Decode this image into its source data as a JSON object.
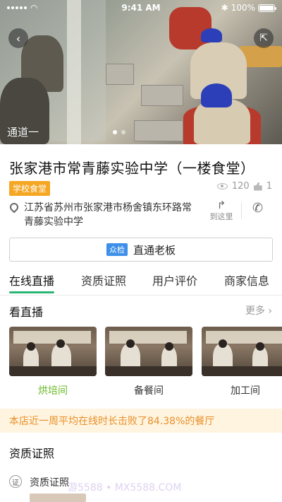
{
  "status_bar": {
    "time": "9:41 AM",
    "battery": "100%"
  },
  "hero": {
    "channel_label": "通道一"
  },
  "store": {
    "name": "张家港市常青藤实验中学（一楼食堂）",
    "tag": "学校食堂",
    "views": "120",
    "likes": "1",
    "address": "江苏省苏州市张家港市杨舍镇东环路常青藤实验中学",
    "route_label": "到这里"
  },
  "boss": {
    "badge": "众检",
    "label": "直通老板"
  },
  "tabs": [
    "在线直播",
    "资质证照",
    "用户评价",
    "商家信息"
  ],
  "live": {
    "heading": "看直播",
    "more": "更多",
    "cameras": [
      "烘培间",
      "备餐间",
      "加工间"
    ]
  },
  "banner": "本店近一周平均在线时长击败了84.38%的餐厅",
  "qualification": {
    "heading": "资质证照",
    "icon_text": "证",
    "label": "资质证照"
  },
  "watermark": "游5588 • MX5588.COM",
  "colors": {
    "accent_green": "#2bb673",
    "tag_orange": "#f5a623",
    "banner_text": "#e8902a",
    "badge_blue": "#3d8fe8"
  }
}
